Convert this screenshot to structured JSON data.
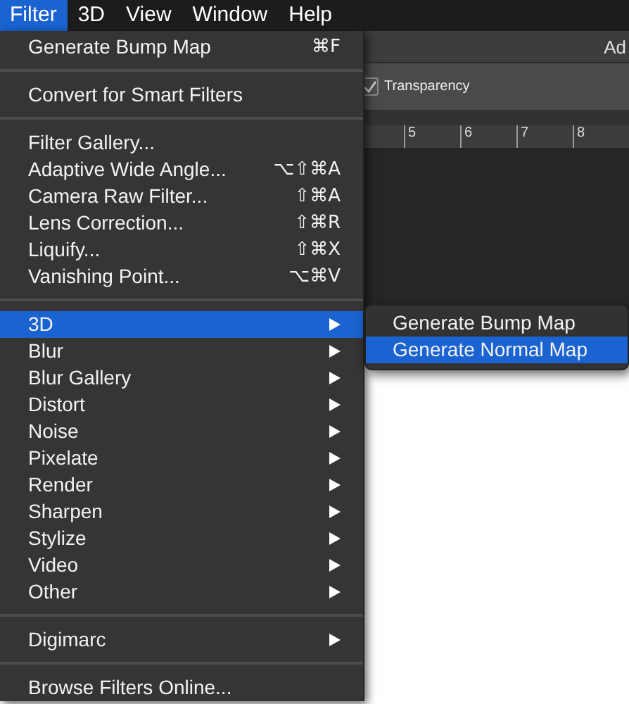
{
  "menubar": [
    {
      "label": "Filter",
      "selected": true
    },
    {
      "label": "3D",
      "selected": false
    },
    {
      "label": "View",
      "selected": false
    },
    {
      "label": "Window",
      "selected": false
    },
    {
      "label": "Help",
      "selected": false
    }
  ],
  "background": {
    "title": "Ad",
    "option": {
      "label": "Transparency",
      "checked": true
    },
    "ruler": [
      "5",
      "6",
      "7",
      "8"
    ]
  },
  "menu": {
    "items": [
      {
        "kind": "item",
        "label": "Generate Bump Map",
        "shortcut": "⌘F",
        "selected": false
      },
      {
        "kind": "separator"
      },
      {
        "kind": "item",
        "label": "Convert for Smart Filters",
        "selected": false
      },
      {
        "kind": "separator"
      },
      {
        "kind": "item",
        "label": "Filter Gallery...",
        "selected": false
      },
      {
        "kind": "item",
        "label": "Adaptive Wide Angle...",
        "shortcut": "⌥⇧⌘A",
        "selected": false
      },
      {
        "kind": "item",
        "label": "Camera Raw Filter...",
        "shortcut": "⇧⌘A",
        "selected": false
      },
      {
        "kind": "item",
        "label": "Lens Correction...",
        "shortcut": "⇧⌘R",
        "selected": false
      },
      {
        "kind": "item",
        "label": "Liquify...",
        "shortcut": "⇧⌘X",
        "selected": false
      },
      {
        "kind": "item",
        "label": "Vanishing Point...",
        "shortcut": "⌥⌘V",
        "selected": false
      },
      {
        "kind": "separator"
      },
      {
        "kind": "submenu",
        "label": "3D",
        "selected": true
      },
      {
        "kind": "submenu",
        "label": "Blur",
        "selected": false
      },
      {
        "kind": "submenu",
        "label": "Blur Gallery",
        "selected": false
      },
      {
        "kind": "submenu",
        "label": "Distort",
        "selected": false
      },
      {
        "kind": "submenu",
        "label": "Noise",
        "selected": false
      },
      {
        "kind": "submenu",
        "label": "Pixelate",
        "selected": false
      },
      {
        "kind": "submenu",
        "label": "Render",
        "selected": false
      },
      {
        "kind": "submenu",
        "label": "Sharpen",
        "selected": false
      },
      {
        "kind": "submenu",
        "label": "Stylize",
        "selected": false
      },
      {
        "kind": "submenu",
        "label": "Video",
        "selected": false
      },
      {
        "kind": "submenu",
        "label": "Other",
        "selected": false
      },
      {
        "kind": "separator"
      },
      {
        "kind": "submenu",
        "label": "Digimarc",
        "selected": false
      },
      {
        "kind": "separator"
      },
      {
        "kind": "item",
        "label": "Browse Filters Online...",
        "selected": false
      }
    ]
  },
  "submenu": {
    "items": [
      {
        "label": "Generate Bump Map",
        "selected": false
      },
      {
        "label": "Generate Normal Map",
        "selected": true
      }
    ]
  }
}
